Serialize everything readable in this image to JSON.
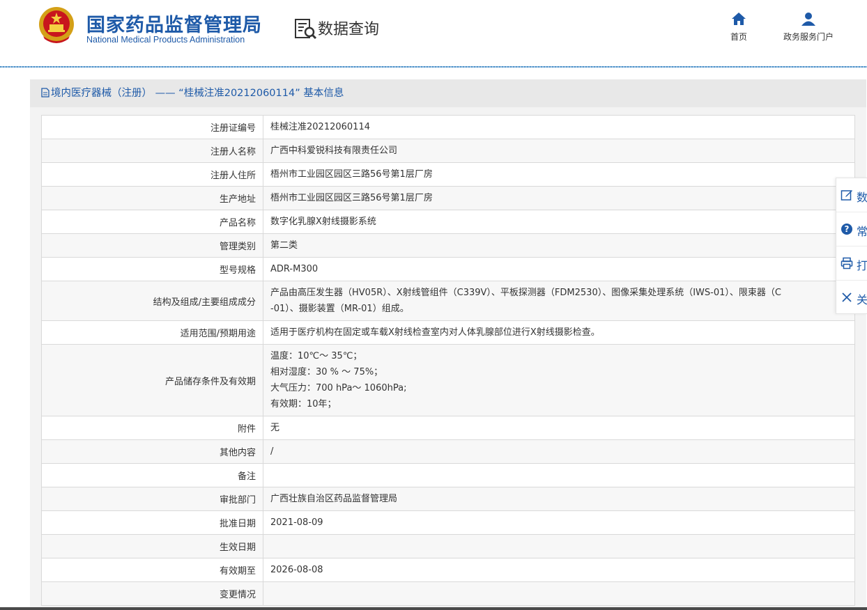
{
  "header": {
    "title_cn": "国家药品监督管理局",
    "title_en": "National Medical Products Administration",
    "query_label": "数据查询",
    "nav": [
      {
        "label": "首页",
        "icon": "home-icon"
      },
      {
        "label": "政务服务门户",
        "icon": "user-icon"
      }
    ]
  },
  "panel": {
    "title": "境内医疗器械（注册） —— “桂械注准20212060114” 基本信息"
  },
  "rows": [
    {
      "key": "注册证编号",
      "value": "桂械注准20212060114"
    },
    {
      "key": "注册人名称",
      "value": "广西中科爱锐科技有限责任公司"
    },
    {
      "key": "注册人住所",
      "value": "梧州市工业园区园区三路56号第1层厂房"
    },
    {
      "key": "生产地址",
      "value": "梧州市工业园区园区三路56号第1层厂房"
    },
    {
      "key": "产品名称",
      "value": "数字化乳腺X射线摄影系统"
    },
    {
      "key": "管理类别",
      "value": "第二类"
    },
    {
      "key": "型号规格",
      "value": "ADR-M300"
    },
    {
      "key": "结构及组成/主要组成成分",
      "lines": [
        "产品由高压发生器（HV05R）、X射线管组件（C339V）、平板探测器（FDM2530）、图像采集处理系统（IWS-01）、限束器（C",
        "-01）、摄影装置（MR-01）组成。"
      ]
    },
    {
      "key": "适用范围/预期用途",
      "value": "适用于医疗机构在固定或车载X射线检查室内对人体乳腺部位进行X射线摄影检查。"
    },
    {
      "key": "产品储存条件及有效期",
      "lines": [
        "温度：10℃～ 35℃；",
        "相对湿度：30 % ～ 75%；",
        "大气压力：700 hPa～ 1060hPa;",
        "有效期：10年；"
      ]
    },
    {
      "key": "附件",
      "value": "无"
    },
    {
      "key": "其他内容",
      "value": "/"
    },
    {
      "key": "备注",
      "value": ""
    },
    {
      "key": "审批部门",
      "value": "广西壮族自治区药品监督管理局"
    },
    {
      "key": "批准日期",
      "value": "2021-08-09"
    },
    {
      "key": "生效日期",
      "value": ""
    },
    {
      "key": "有效期至",
      "value": "2026-08-08"
    },
    {
      "key": "变更情况",
      "value": ""
    }
  ],
  "floatbar": [
    {
      "label": "数",
      "icon": "edit-icon"
    },
    {
      "label": "常",
      "icon": "help-icon"
    },
    {
      "label": "打",
      "icon": "print-icon"
    },
    {
      "label": "关",
      "icon": "close-icon"
    }
  ],
  "colors": {
    "brand": "#1e5aa8",
    "panel_bg": "#f3f3f3",
    "row_alt": "#f7f7f7",
    "border": "#d9d9d9"
  }
}
